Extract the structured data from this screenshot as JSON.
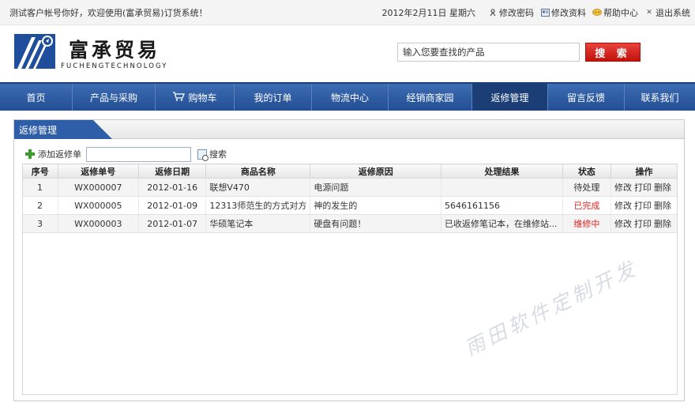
{
  "topbar": {
    "greeting": "测试客户帐号你好，欢迎使用(富承贸易)订货系统！",
    "date": "2012年2月11日 星期六",
    "links": [
      {
        "label": "修改密码",
        "icon": "key-icon"
      },
      {
        "label": "修改资料",
        "icon": "profile-icon"
      },
      {
        "label": "帮助中心",
        "icon": "help-icon"
      },
      {
        "label": "退出系统",
        "icon": "close-icon"
      }
    ]
  },
  "header": {
    "brand_cn": "富承贸易",
    "brand_en": "FUCHENGTECHNOLOGY",
    "search_placeholder": "输入您要查找的产品",
    "search_button": "搜 索"
  },
  "nav": {
    "items": [
      {
        "label": "首页"
      },
      {
        "label": "产品与采购"
      },
      {
        "label": "购物车"
      },
      {
        "label": "我的订单"
      },
      {
        "label": "物流中心"
      },
      {
        "label": "经销商家园"
      },
      {
        "label": "返修管理"
      },
      {
        "label": "留言反馈"
      },
      {
        "label": "联系我们"
      }
    ],
    "active_index": 6
  },
  "panel": {
    "title": "返修管理",
    "add_label": "添加返修单",
    "search_label": "搜索"
  },
  "table": {
    "headers": [
      "序号",
      "返修单号",
      "返修日期",
      "商品名称",
      "返修原因",
      "处理结果",
      "状态",
      "操作"
    ],
    "rows": [
      {
        "no": "1",
        "code": "WX000007",
        "date": "2012-01-16",
        "product": "联想V470",
        "reason": "电源问题",
        "result": "",
        "status": "待处理",
        "status_color": "#333333"
      },
      {
        "no": "2",
        "code": "WX000005",
        "date": "2012-01-09",
        "product": "12313师范生的方式对方",
        "reason": "神的发生的",
        "result": "5646161156",
        "status": "已完成",
        "status_color": "#e0221b"
      },
      {
        "no": "3",
        "code": "WX000003",
        "date": "2012-01-07",
        "product": "华硕笔记本",
        "reason": "硬盘有问题！",
        "result": "已收返修笔记本，在维修站...",
        "status": "维修中",
        "status_color": "#e0221b"
      }
    ],
    "ops": [
      "修改",
      "打印",
      "删除"
    ]
  },
  "watermark": "雨田软件定制开发"
}
